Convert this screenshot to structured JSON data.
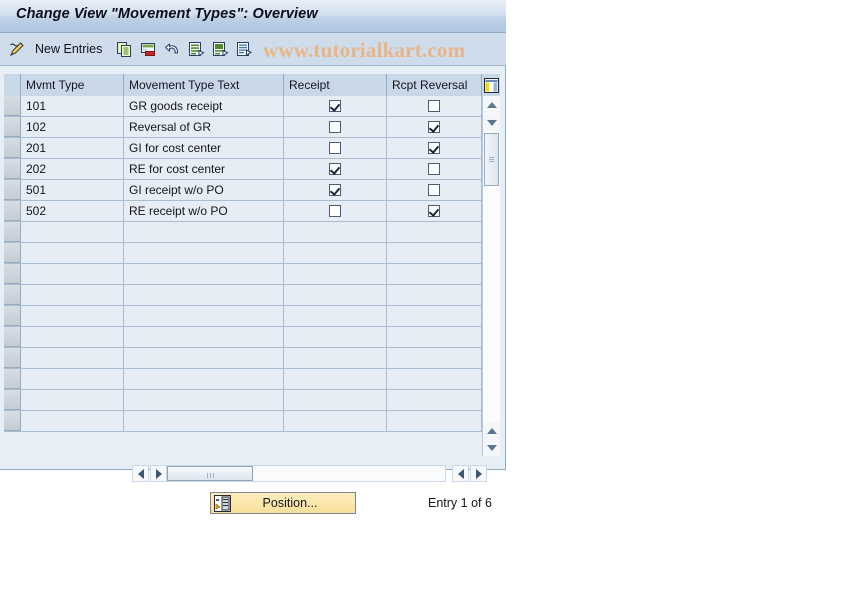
{
  "window": {
    "title": "Change View \"Movement Types\": Overview"
  },
  "toolbar": {
    "new_entries_label": "New Entries",
    "icons": [
      {
        "name": "pencil-new-entries-icon",
        "title": "New Entries"
      },
      {
        "name": "copy-icon",
        "title": "Copy As"
      },
      {
        "name": "delete-icon",
        "title": "Delete"
      },
      {
        "name": "undo-icon",
        "title": "Undo Change"
      },
      {
        "name": "select-all-icon",
        "title": "Select All"
      },
      {
        "name": "deselect-all-icon",
        "title": "Deselect All"
      },
      {
        "name": "details-icon",
        "title": "Details"
      }
    ]
  },
  "watermark": {
    "text": "www.tutorialkart.com",
    "color": "#eab584"
  },
  "table": {
    "columns": [
      {
        "key": "mvmt_type",
        "label": "Mvmt Type"
      },
      {
        "key": "movement_type_text",
        "label": "Movement Type Text"
      },
      {
        "key": "receipt",
        "label": "Receipt"
      },
      {
        "key": "rcpt_reversal",
        "label": "Rcpt Reversal"
      }
    ],
    "config_icon": "table-settings-icon",
    "rows": [
      {
        "mvmt_type": "101",
        "movement_type_text": "GR goods receipt",
        "receipt": true,
        "rcpt_reversal": false
      },
      {
        "mvmt_type": "102",
        "movement_type_text": "Reversal of GR",
        "receipt": false,
        "rcpt_reversal": true
      },
      {
        "mvmt_type": "201",
        "movement_type_text": "GI for cost center",
        "receipt": false,
        "rcpt_reversal": true
      },
      {
        "mvmt_type": "202",
        "movement_type_text": "RE for cost center",
        "receipt": true,
        "rcpt_reversal": false
      },
      {
        "mvmt_type": "501",
        "movement_type_text": "GI receipt w/o PO",
        "receipt": true,
        "rcpt_reversal": false
      },
      {
        "mvmt_type": "502",
        "movement_type_text": "RE receipt w/o PO",
        "receipt": false,
        "rcpt_reversal": true
      }
    ],
    "empty_row_count": 10
  },
  "footer": {
    "position_button_label": "Position...",
    "position_button_icon": "position-icon",
    "entry_status": "Entry 1 of 6"
  },
  "colors": {
    "title_bar": "#bfd2e7",
    "toolbar": "#cedceb",
    "grid_header": "#c8d8e8",
    "row_bg": "#e6edf5",
    "panel_bg": "#e8eef6",
    "button_yellow": "#f8e09a"
  }
}
